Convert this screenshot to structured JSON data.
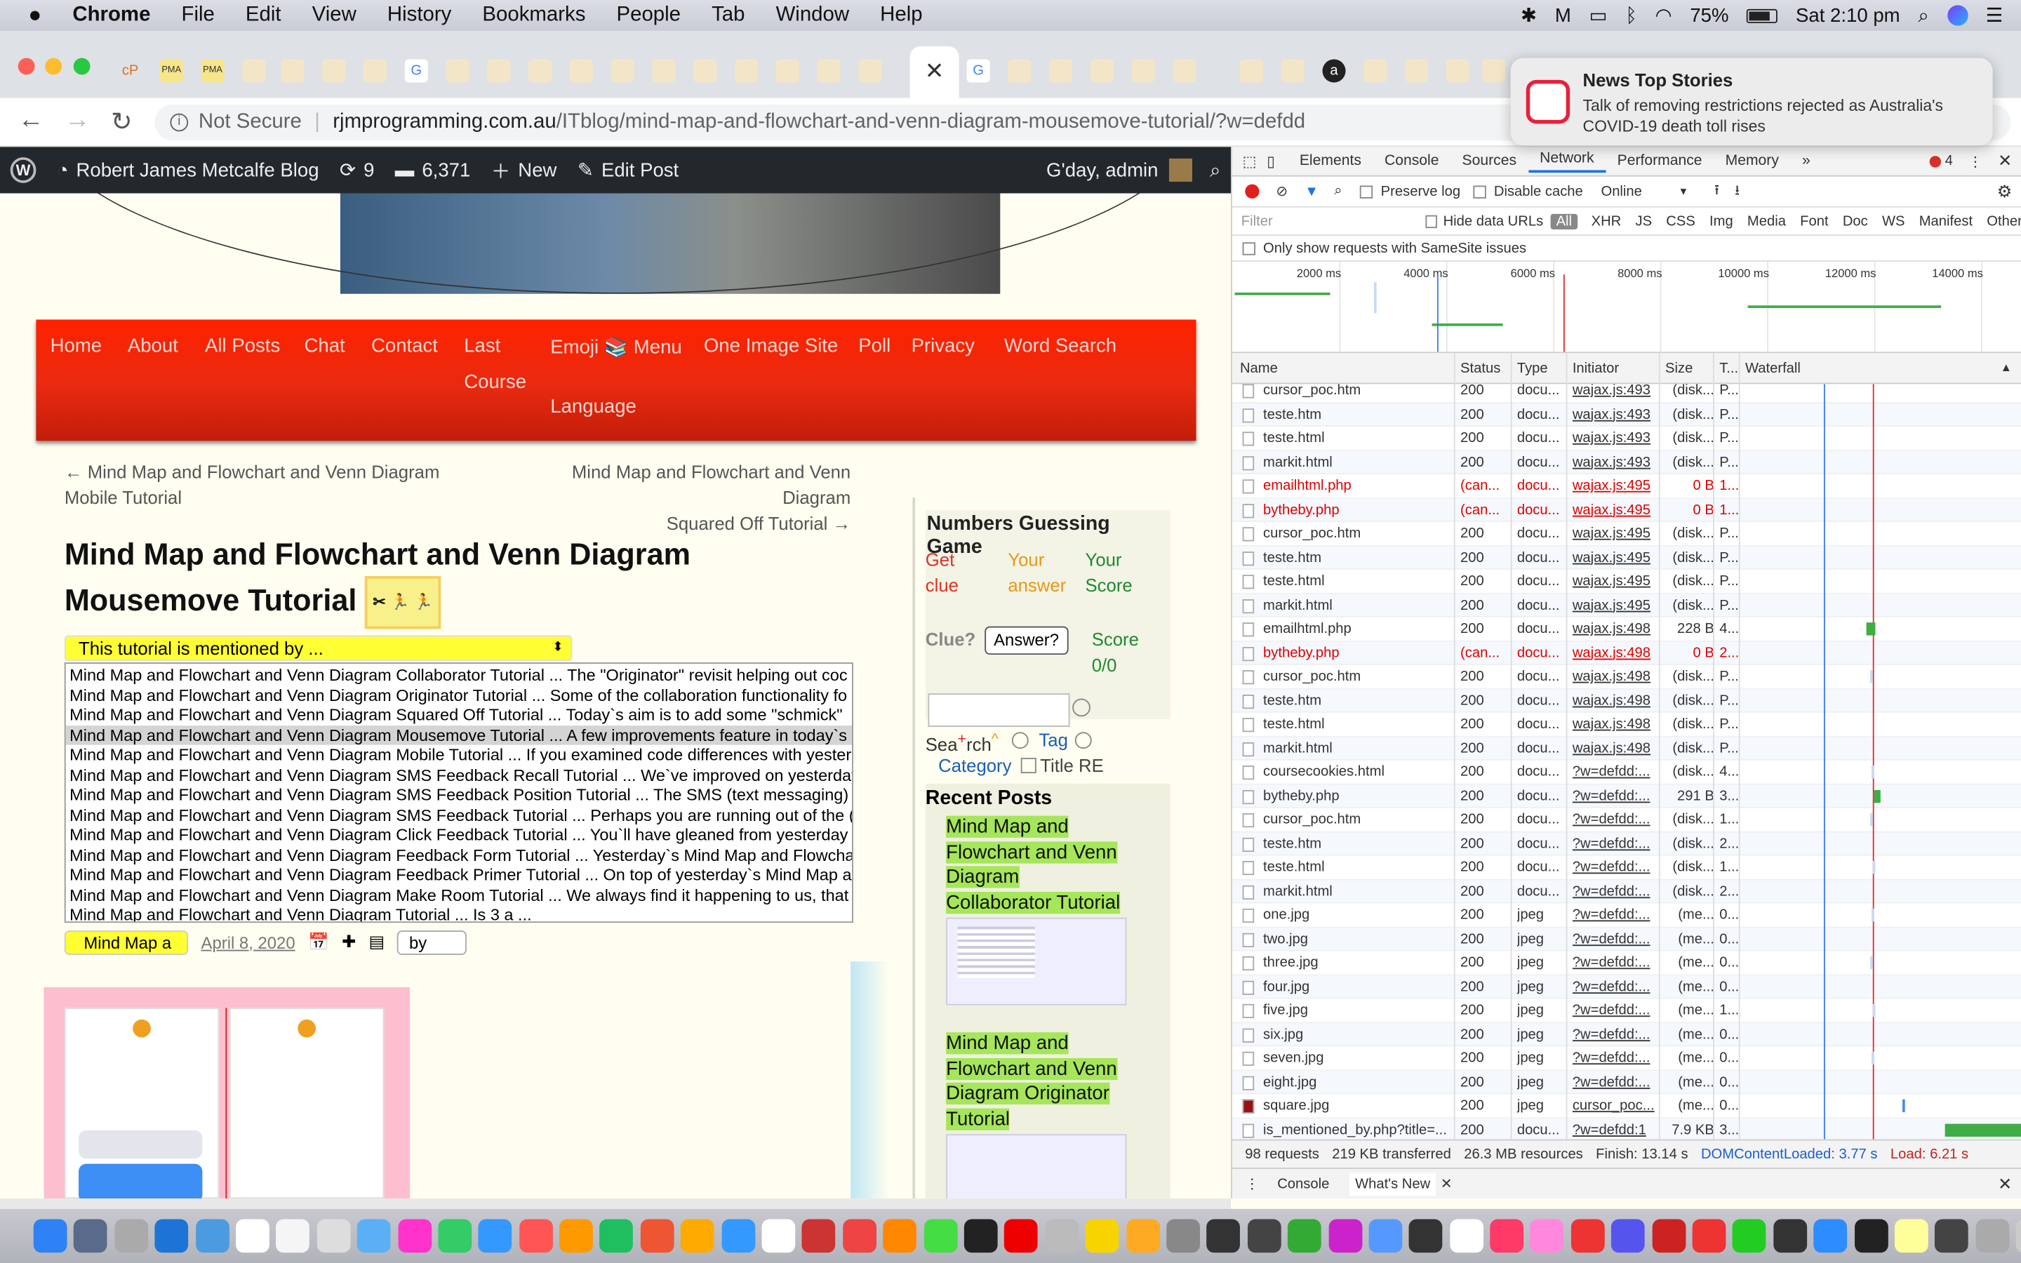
{
  "menubar": {
    "app": "Chrome",
    "items": [
      "File",
      "Edit",
      "View",
      "History",
      "Bookmarks",
      "People",
      "Tab",
      "Window",
      "Help"
    ],
    "battery": "75%",
    "clock": "Sat 2:10 pm"
  },
  "tabs": {
    "fav_labels": [
      "cP",
      "PMA",
      "PMA",
      "G",
      "G",
      "a"
    ],
    "close_glyph": "✕"
  },
  "address": {
    "security": "Not Secure",
    "domain": "rjmprogramming.com.au",
    "path": "/ITblog/mind-map-and-flowchart-and-venn-diagram-mousemove-tutorial/?w=defdd"
  },
  "notification": {
    "title": "News Top Stories",
    "body": "Talk of removing restrictions rejected as Australia's COVID-19 death toll rises"
  },
  "wpbar": {
    "site": "Robert James Metcalfe Blog",
    "updates": "9",
    "comments": "6,371",
    "new": "New",
    "edit": "Edit Post",
    "greeting": "G'day, admin"
  },
  "nav": {
    "items": [
      "Home",
      "About",
      "All Posts",
      "Chat",
      "Contact",
      "Last",
      "Emoji 📚 Menu",
      "One Image Site",
      "Poll",
      "Privacy",
      "Word Search"
    ],
    "course": "Course",
    "language": "Language"
  },
  "postnav": {
    "prev1": "← Mind Map and Flowchart and Venn Diagram",
    "prev2": "Mobile Tutorial",
    "next1": "Mind Map and Flowchart and Venn Diagram",
    "next2": "Squared Off Tutorial →"
  },
  "post": {
    "title": "Mind Map and Flowchart and Venn Diagram Mousemove Tutorial",
    "emoji": "✂ 🏃 🏃",
    "mentioned_label": "This tutorial is mentioned by ...",
    "mentions": [
      "Mind Map and Flowchart and Venn Diagram Collaborator Tutorial ... The \"Originator\" revisit helping out coc",
      "Mind Map and Flowchart and Venn Diagram Originator Tutorial ... Some of the collaboration functionality fo",
      "Mind Map and Flowchart and Venn Diagram Squared Off Tutorial ... Today`s aim is to add some \"schmick\"",
      "Mind Map and Flowchart and Venn Diagram Mousemove Tutorial ... A few improvements feature in today`s",
      "Mind Map and Flowchart and Venn Diagram Mobile Tutorial ... If you examined code differences with yester",
      "Mind Map and Flowchart and Venn Diagram SMS Feedback Recall Tutorial ... We`ve improved on yesterday",
      "Mind Map and Flowchart and Venn Diagram SMS Feedback Position Tutorial ... The SMS (text messaging) s",
      "Mind Map and Flowchart and Venn Diagram SMS Feedback Tutorial ... Perhaps you are running out of the (",
      "Mind Map and Flowchart and Venn Diagram Click Feedback Tutorial ... You`ll have gleaned from yesterday",
      "Mind Map and Flowchart and Venn Diagram Feedback Form Tutorial ... Yesterday`s Mind Map and Flowcha",
      "Mind Map and Flowchart and Venn Diagram Feedback Primer Tutorial ... On top of yesterday`s Mind Map a",
      "Mind Map and Flowchart and Venn Diagram Make Room Tutorial ... We always find it happening to us, that",
      "Mind Map and Flowchart and Venn Diagram Tutorial ... Is 3 a ..."
    ],
    "category": "Mind Map a",
    "date": "April 8, 2020",
    "by": "by"
  },
  "widget": {
    "title": "Numbers Guessing Game",
    "get": "Get",
    "clue": "clue",
    "your1": "Your",
    "answer": "answer",
    "your2": "Your",
    "score": "Score",
    "clue_q": "Clue?",
    "answer_sel": "Answer?",
    "score_lbl": "Score",
    "score_val": "0/0",
    "search_a": "Sea",
    "search_b": "rch",
    "tag": "Tag",
    "category": "Category",
    "title_re": "Title RE",
    "recent": "Recent Posts",
    "recent1": "Mind Map and Flowchart and Venn Diagram Collaborator Tutorial",
    "recent2": "Mind Map and Flowchart and Venn Diagram Originator Tutorial"
  },
  "devtools": {
    "tabs": [
      "Elements",
      "Console",
      "Sources",
      "Network",
      "Performance",
      "Memory"
    ],
    "errors": "4",
    "preserve": "Preserve log",
    "disable": "Disable cache",
    "online": "Online",
    "filter_ph": "Filter",
    "hide_data": "Hide data URLs",
    "types": [
      "All",
      "XHR",
      "JS",
      "CSS",
      "Img",
      "Media",
      "Font",
      "Doc",
      "WS",
      "Manifest",
      "Other"
    ],
    "samesite": "Only show requests with SameSite issues",
    "ticks": [
      "2000 ms",
      "4000 ms",
      "6000 ms",
      "8000 ms",
      "10000 ms",
      "12000 ms",
      "14000 ms"
    ],
    "cols": {
      "name": "Name",
      "status": "Status",
      "type": "Type",
      "initiator": "Initiator",
      "size": "Size",
      "time": "T...",
      "waterfall": "Waterfall"
    },
    "rows": [
      {
        "n": "cursor_poc.htm",
        "s": "200",
        "t": "docu...",
        "i": "wajax.js:493",
        "z": "(disk...",
        "m": "P...",
        "red": false
      },
      {
        "n": "teste.htm",
        "s": "200",
        "t": "docu...",
        "i": "wajax.js:493",
        "z": "(disk...",
        "m": "P...",
        "red": false
      },
      {
        "n": "teste.html",
        "s": "200",
        "t": "docu...",
        "i": "wajax.js:493",
        "z": "(disk...",
        "m": "P...",
        "red": false
      },
      {
        "n": "markit.html",
        "s": "200",
        "t": "docu...",
        "i": "wajax.js:493",
        "z": "(disk...",
        "m": "P...",
        "red": false
      },
      {
        "n": "emailhtml.php",
        "s": "(can...",
        "t": "docu...",
        "i": "wajax.js:495",
        "z": "0 B",
        "m": "1...",
        "red": true
      },
      {
        "n": "bytheby.php",
        "s": "(can...",
        "t": "docu...",
        "i": "wajax.js:495",
        "z": "0 B",
        "m": "1...",
        "red": true
      },
      {
        "n": "cursor_poc.htm",
        "s": "200",
        "t": "docu...",
        "i": "wajax.js:495",
        "z": "(disk...",
        "m": "P...",
        "red": false
      },
      {
        "n": "teste.htm",
        "s": "200",
        "t": "docu...",
        "i": "wajax.js:495",
        "z": "(disk...",
        "m": "P...",
        "red": false
      },
      {
        "n": "teste.html",
        "s": "200",
        "t": "docu...",
        "i": "wajax.js:495",
        "z": "(disk...",
        "m": "P...",
        "red": false
      },
      {
        "n": "markit.html",
        "s": "200",
        "t": "docu...",
        "i": "wajax.js:495",
        "z": "(disk...",
        "m": "P...",
        "red": false
      },
      {
        "n": "emailhtml.php",
        "s": "200",
        "t": "docu...",
        "i": "wajax.js:498",
        "z": "228 B",
        "m": "4...",
        "red": false
      },
      {
        "n": "bytheby.php",
        "s": "(can...",
        "t": "docu...",
        "i": "wajax.js:498",
        "z": "0 B",
        "m": "2...",
        "red": true
      },
      {
        "n": "cursor_poc.htm",
        "s": "200",
        "t": "docu...",
        "i": "wajax.js:498",
        "z": "(disk...",
        "m": "P...",
        "red": false
      },
      {
        "n": "teste.htm",
        "s": "200",
        "t": "docu...",
        "i": "wajax.js:498",
        "z": "(disk...",
        "m": "P...",
        "red": false
      },
      {
        "n": "teste.html",
        "s": "200",
        "t": "docu...",
        "i": "wajax.js:498",
        "z": "(disk...",
        "m": "P...",
        "red": false
      },
      {
        "n": "markit.html",
        "s": "200",
        "t": "docu...",
        "i": "wajax.js:498",
        "z": "(disk...",
        "m": "P...",
        "red": false
      },
      {
        "n": "coursecookies.html",
        "s": "200",
        "t": "docu...",
        "i": "?w=defdd:...",
        "z": "(disk...",
        "m": "4...",
        "red": false
      },
      {
        "n": "bytheby.php",
        "s": "200",
        "t": "docu...",
        "i": "?w=defdd:...",
        "z": "291 B",
        "m": "3...",
        "red": false
      },
      {
        "n": "cursor_poc.htm",
        "s": "200",
        "t": "docu...",
        "i": "?w=defdd:...",
        "z": "(disk...",
        "m": "1...",
        "red": false
      },
      {
        "n": "teste.htm",
        "s": "200",
        "t": "docu...",
        "i": "?w=defdd:...",
        "z": "(disk...",
        "m": "2...",
        "red": false
      },
      {
        "n": "teste.html",
        "s": "200",
        "t": "docu...",
        "i": "?w=defdd:...",
        "z": "(disk...",
        "m": "1...",
        "red": false
      },
      {
        "n": "markit.html",
        "s": "200",
        "t": "docu...",
        "i": "?w=defdd:...",
        "z": "(disk...",
        "m": "2...",
        "red": false
      },
      {
        "n": "one.jpg",
        "s": "200",
        "t": "jpeg",
        "i": "?w=defdd:...",
        "z": "(me...",
        "m": "0...",
        "red": false
      },
      {
        "n": "two.jpg",
        "s": "200",
        "t": "jpeg",
        "i": "?w=defdd:...",
        "z": "(me...",
        "m": "0...",
        "red": false
      },
      {
        "n": "three.jpg",
        "s": "200",
        "t": "jpeg",
        "i": "?w=defdd:...",
        "z": "(me...",
        "m": "0...",
        "red": false
      },
      {
        "n": "four.jpg",
        "s": "200",
        "t": "jpeg",
        "i": "?w=defdd:...",
        "z": "(me...",
        "m": "0...",
        "red": false
      },
      {
        "n": "five.jpg",
        "s": "200",
        "t": "jpeg",
        "i": "?w=defdd:...",
        "z": "(me...",
        "m": "1...",
        "red": false
      },
      {
        "n": "six.jpg",
        "s": "200",
        "t": "jpeg",
        "i": "?w=defdd:...",
        "z": "(me...",
        "m": "0...",
        "red": false
      },
      {
        "n": "seven.jpg",
        "s": "200",
        "t": "jpeg",
        "i": "?w=defdd:...",
        "z": "(me...",
        "m": "0...",
        "red": false
      },
      {
        "n": "eight.jpg",
        "s": "200",
        "t": "jpeg",
        "i": "?w=defdd:...",
        "z": "(me...",
        "m": "0...",
        "red": false
      },
      {
        "n": "square.jpg",
        "s": "200",
        "t": "jpeg",
        "i": "cursor_poc...",
        "z": "(me...",
        "m": "0...",
        "red": false
      },
      {
        "n": "is_mentioned_by.php?title=...",
        "s": "200",
        "t": "docu...",
        "i": "?w=defdd:1",
        "z": "7.9 KB",
        "m": "3...",
        "red": false
      }
    ],
    "status": {
      "requests": "98 requests",
      "transferred": "219 KB transferred",
      "resources": "26.3 MB resources",
      "finish": "Finish: 13.14 s",
      "dcl": "DOMContentLoaded: 3.77 s",
      "load": "Load: 6.21 s"
    },
    "drawer": {
      "console": "Console",
      "whatsnew": "What's New"
    }
  }
}
